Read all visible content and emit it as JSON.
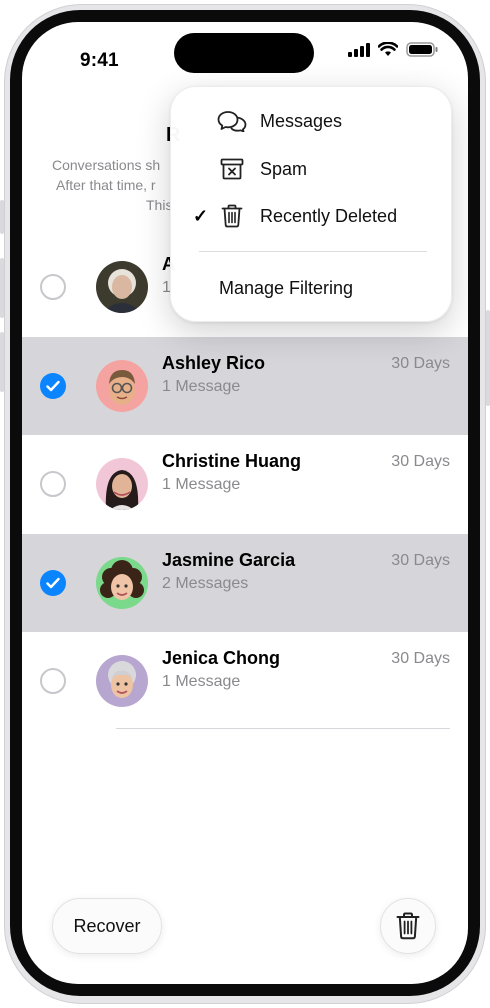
{
  "status_bar": {
    "time": "9:41"
  },
  "header": {
    "title": "R",
    "info_lines": [
      "Conversations sh",
      "After that time, r",
      "This"
    ]
  },
  "menu": {
    "items": [
      {
        "label": "Messages",
        "icon": "speech-bubbles-icon",
        "checked": false
      },
      {
        "label": "Spam",
        "icon": "spam-box-icon",
        "checked": false
      },
      {
        "label": "Recently Deleted",
        "icon": "trash-icon",
        "checked": true
      }
    ],
    "check_glyph": "✓",
    "manage_label": "Manage Filtering"
  },
  "conversations": [
    {
      "name": "A",
      "sub": "1",
      "days": "",
      "selected": false,
      "avatar": "elderly-woman-photo"
    },
    {
      "name": "Ashley Rico",
      "sub": "1 Message",
      "days": "30 Days",
      "selected": true,
      "avatar": "memoji-glasses"
    },
    {
      "name": "Christine Huang",
      "sub": "1 Message",
      "days": "30 Days",
      "selected": false,
      "avatar": "young-woman-photo"
    },
    {
      "name": "Jasmine Garcia",
      "sub": "2 Messages",
      "days": "30 Days",
      "selected": true,
      "avatar": "memoji-curly-hair"
    },
    {
      "name": "Jenica Chong",
      "sub": "1 Message",
      "days": "30 Days",
      "selected": false,
      "avatar": "memoji-gray-hair"
    }
  ],
  "bottom_bar": {
    "recover_label": "Recover"
  },
  "colors": {
    "accent": "#0a84ff",
    "selected_row": "#d6d6da",
    "secondary_text": "#8a8a8e"
  }
}
